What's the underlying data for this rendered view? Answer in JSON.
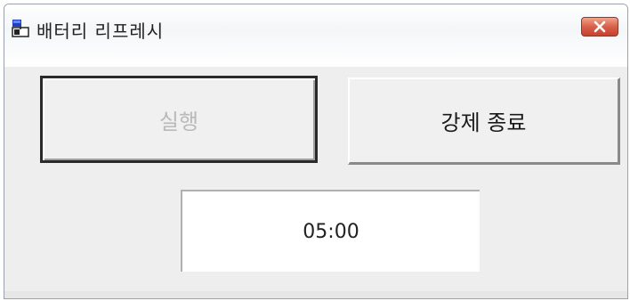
{
  "window": {
    "title": "배터리 리프레시",
    "app_icon": "battery-window-icon",
    "close_icon": "close-icon"
  },
  "buttons": {
    "run_label": "실행",
    "run_enabled": false,
    "force_quit_label": "강제 종료"
  },
  "timer": {
    "value": "05:00"
  },
  "colors": {
    "close_button": "#d8604a",
    "disabled_text": "#b9b9b9",
    "window_bg": "#eeeeee"
  }
}
